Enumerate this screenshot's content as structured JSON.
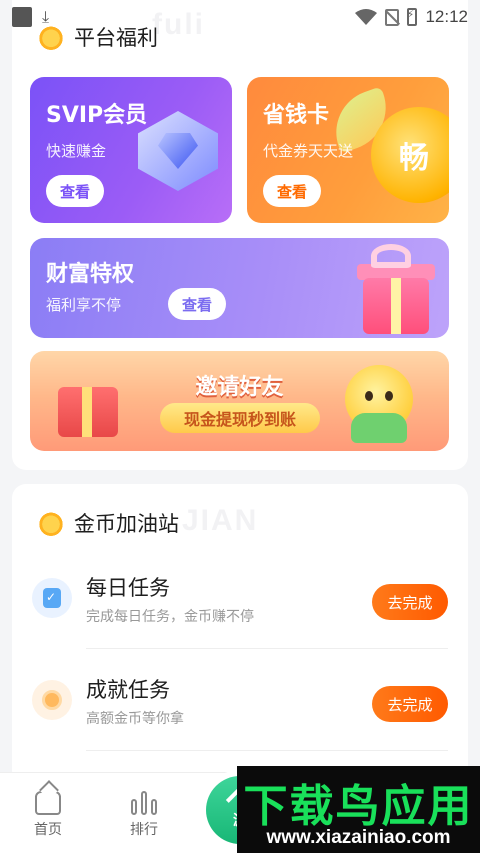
{
  "status_bar": {
    "time": "12:12"
  },
  "platform_welfare": {
    "title": "平台福利",
    "watermark": "fuli",
    "svip": {
      "title": "SVIP会员",
      "subtitle": "快速赚金",
      "button": "查看"
    },
    "save_card": {
      "title": "省钱卡",
      "subtitle": "代金券天天送",
      "button": "查看",
      "coin_text": "畅"
    },
    "wealth": {
      "title": "财富特权",
      "subtitle": "福利享不停",
      "button": "查看"
    },
    "invite": {
      "title": "邀请好友",
      "pill": "现金提现秒到账"
    }
  },
  "coin_station": {
    "title": "金币加油站",
    "watermark": "JIAN",
    "tasks": [
      {
        "name": "每日任务",
        "desc": "完成每日任务，金币赚不停",
        "button": "去完成",
        "icon": "daily-task-icon"
      },
      {
        "name": "成就任务",
        "desc": "高额金币等你拿",
        "button": "去完成",
        "icon": "achievement-icon"
      }
    ]
  },
  "tab_bar": {
    "home": "首页",
    "rank": "排行",
    "game": "游"
  },
  "promo": {
    "title": "下载鸟应用",
    "url": "www.xiazainiao.com"
  },
  "colors": {
    "accent_orange": "#ff6a00",
    "svip_purple": "#7b52f7",
    "save_orange": "#ff8a3d",
    "game_green": "#18b776",
    "promo_green": "#19e05a"
  }
}
